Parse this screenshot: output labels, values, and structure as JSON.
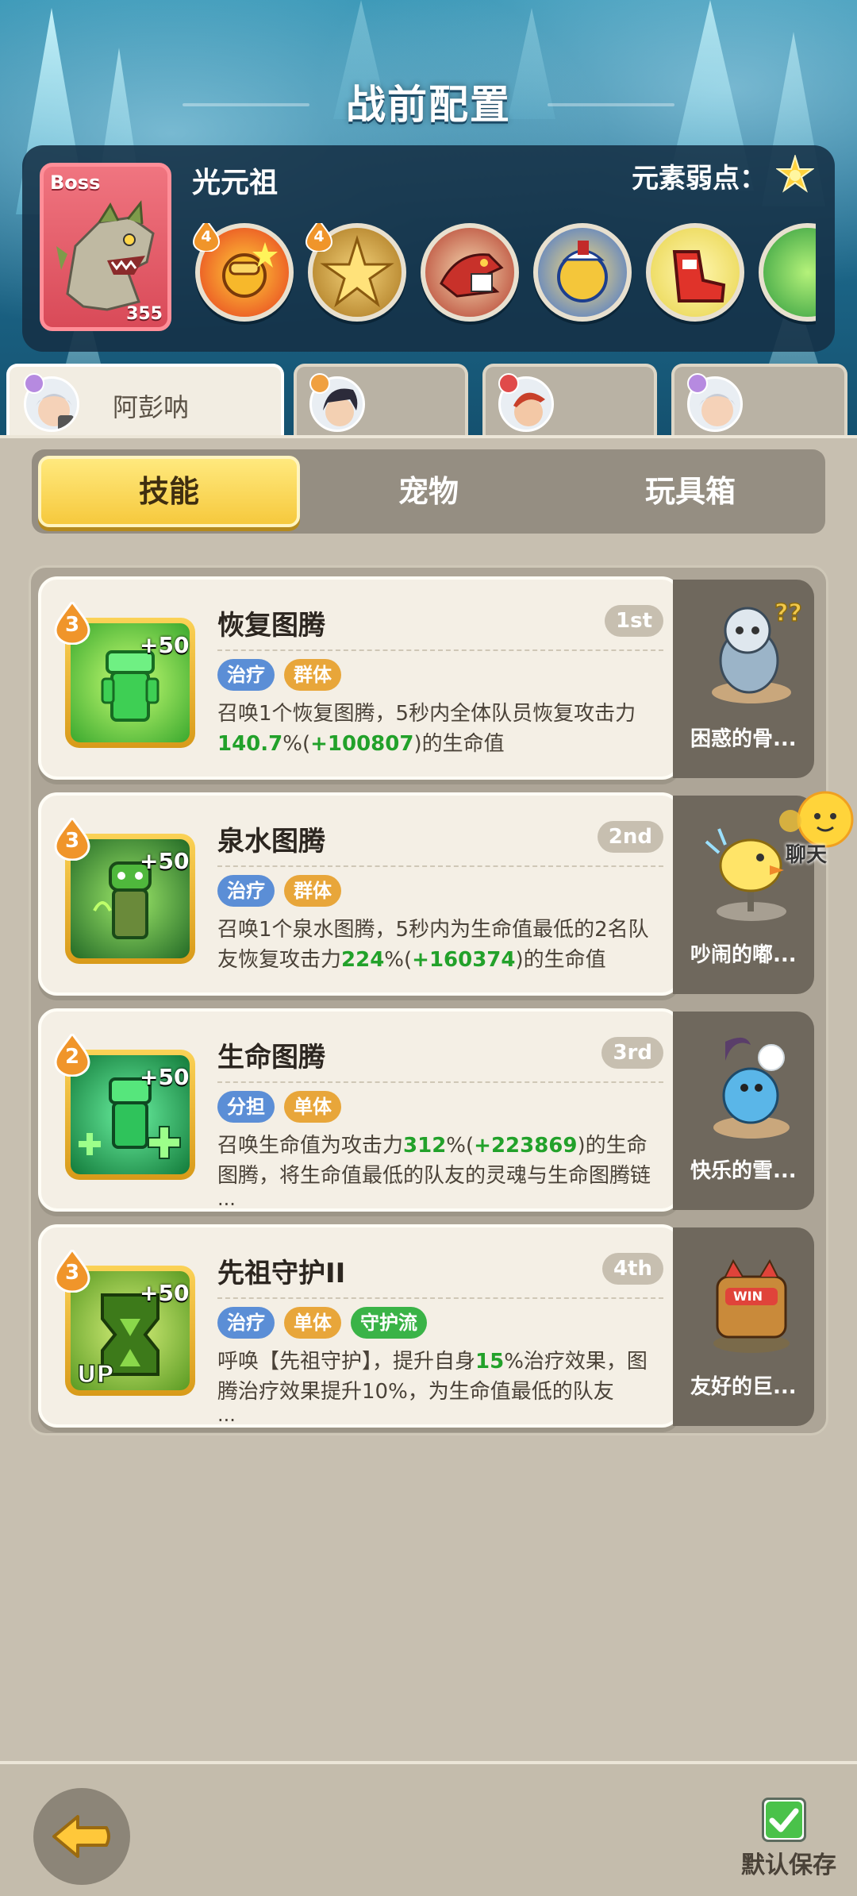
{
  "header": {
    "title": "战前配置"
  },
  "boss": {
    "badge": "Boss",
    "name": "光元祖",
    "level": "355",
    "weakness_label": "元素弱点：",
    "weakness_icon": "light-star-icon",
    "skills": [
      {
        "icon": "punch-skill-icon",
        "level": "4"
      },
      {
        "icon": "golden-burst-skill-icon",
        "level": "4"
      },
      {
        "icon": "red-beast-skill-icon",
        "level": ""
      },
      {
        "icon": "blue-chick-skill-icon",
        "level": ""
      },
      {
        "icon": "red-boot-skill-icon",
        "level": ""
      },
      {
        "icon": "green-skill-icon",
        "level": ""
      }
    ]
  },
  "characters": [
    {
      "name": "阿彭呐",
      "active": true
    },
    {
      "name": "",
      "active": false
    },
    {
      "name": "",
      "active": false
    },
    {
      "name": "",
      "active": false
    }
  ],
  "tabs": [
    {
      "label": "技能",
      "active": true
    },
    {
      "label": "宠物",
      "active": false
    },
    {
      "label": "玩具箱",
      "active": false
    }
  ],
  "skills": [
    {
      "title": "恢复图腾",
      "order": "1st",
      "level": "3",
      "bonus": "+50",
      "tags": [
        "治疗",
        "群体"
      ],
      "desc_a": "召唤1个恢复图腾，5秒内全体队员恢复攻击力",
      "desc_num1": "140.7",
      "desc_b": "%(",
      "desc_num2": "+100807",
      "desc_c": ")的生命值",
      "ellipsis": ""
    },
    {
      "title": "泉水图腾",
      "order": "2nd",
      "level": "3",
      "bonus": "+50",
      "tags": [
        "治疗",
        "群体"
      ],
      "desc_a": "召唤1个泉水图腾，5秒内为生命值最低的2名队友恢复攻击力",
      "desc_num1": "224",
      "desc_b": "%(",
      "desc_num2": "+160374",
      "desc_c": ")的生命值",
      "ellipsis": ""
    },
    {
      "title": "生命图腾",
      "order": "3rd",
      "level": "2",
      "bonus": "+50",
      "tags": [
        "分担",
        "单体"
      ],
      "desc_a": "召唤生命值为攻击力",
      "desc_num1": "312",
      "desc_b": "%(",
      "desc_num2": "+223869",
      "desc_c": ")的生命图腾，将生命值最低的队友的灵魂与生命图腾链",
      "ellipsis": "..."
    },
    {
      "title": "先祖守护II",
      "order": "4th",
      "level": "3",
      "bonus": "+50",
      "tags": [
        "治疗",
        "单体",
        "守护流"
      ],
      "desc_a": "呼唤【先祖守护】，提升自身",
      "desc_num1": "15",
      "desc_b": "%治疗效果，图腾治疗效果提升10%，为生命值最低的队友",
      "desc_num2": "",
      "desc_c": "",
      "ellipsis": "..."
    }
  ],
  "pets": [
    {
      "name": "困惑的骨..."
    },
    {
      "name": "吵闹的嘟..."
    },
    {
      "name": "快乐的雪..."
    },
    {
      "name": "友好的巨..."
    }
  ],
  "chat": {
    "label": "聊天"
  },
  "footer": {
    "save_label": "默认保存",
    "save_checked": true
  },
  "colors": {
    "accent_yellow": "#f6c93d",
    "tag_blue": "#5b8ed6",
    "tag_orange": "#e8a63a",
    "tag_green": "#3ab347",
    "highlight_green": "#22a12a"
  }
}
